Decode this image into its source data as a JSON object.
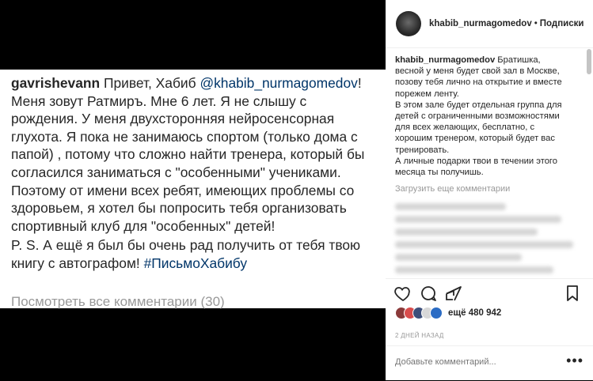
{
  "post": {
    "username": "gavrishevann",
    "greeting": " Привет, Хабиб",
    "mention": "@khabib_nurmagomedov",
    "body1": "! Меня зовут Ратмиръ. Мне 6 лет. Я не слышу с рождения. У меня двухсторонняя нейросенсорная глухота. Я пока не занимаюсь спортом (только дома с папой) , потому что сложно найти тренера, который бы согласился заниматься с \"особенными\" учениками. Поэтому от имени всех ребят, имеющих проблемы со здоровьем, я хотел бы попросить тебя организовать спортивный клуб для \"особенных\" детей!",
    "ps": "P. S. А ещё я был бы очень рад получить от тебя твою книгу с автографом! ",
    "hashtag": "#ПисьмоХабибу",
    "view_all": "Посмотреть все комментарии (30)"
  },
  "sidebar": {
    "header": {
      "username": "khabib_nurmagomedov",
      "dot": "•",
      "follow": "Подписки"
    },
    "caption": {
      "username": "khabib_nurmagomedov",
      "text1": " Братишка, весной у меня будет свой зал в Москве, позову тебя лично на открытие и вместе порежем ленту.",
      "text2": "В этом зале будет отдельная группа для детей с ограниченными возможностями для всех желающих, бесплатно, с хорошим тренером, который будет вас тренировать.",
      "text3": "А личные подарки твои в течении этого месяца ты получишь."
    },
    "load_more": "Загрузить еще комментарии",
    "likes": "ещё 480 942",
    "time": "2 ДНЕЙ НАЗАД",
    "add_comment_placeholder": "Добавьте комментарий...",
    "more": "•••"
  },
  "icons": [
    "heart-icon",
    "comment-icon",
    "share-icon",
    "bookmark-icon"
  ]
}
